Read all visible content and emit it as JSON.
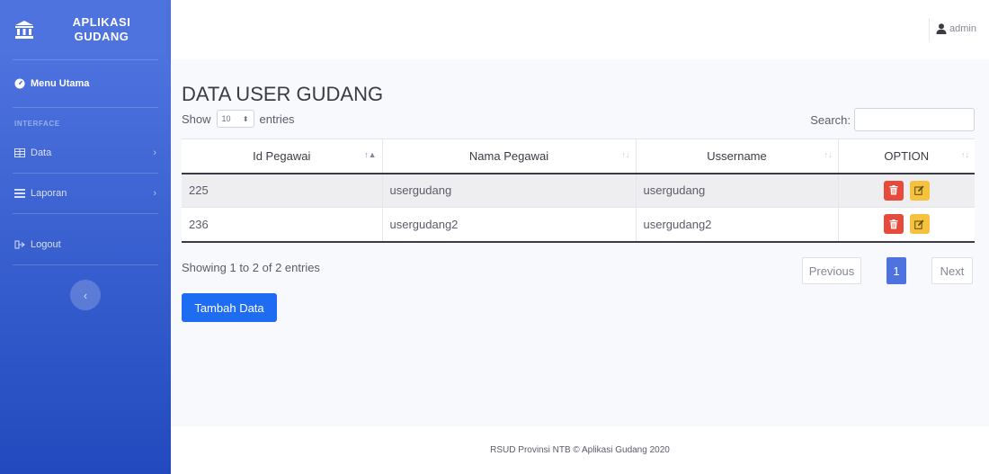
{
  "sidebar": {
    "brand_line1": "APLIKASI",
    "brand_line2": "GUDANG",
    "menu_utama": "Menu Utama",
    "heading": "INTERFACE",
    "items": [
      {
        "label": "Data",
        "icon": "table-icon"
      },
      {
        "label": "Laporan",
        "icon": "list-icon"
      }
    ],
    "logout": "Logout"
  },
  "topbar": {
    "user": "admin"
  },
  "main": {
    "title": "DATA USER GUDANG",
    "show_label": "Show",
    "entries_value": "10",
    "entries_label": "entries",
    "search_label": "Search:",
    "search_value": ""
  },
  "table": {
    "columns": [
      "Id Pegawai",
      "Nama Pegawai",
      "Ussername",
      "OPTION"
    ],
    "rows": [
      {
        "id": "225",
        "nama": "usergudang",
        "username": "usergudang"
      },
      {
        "id": "236",
        "nama": "usergudang2",
        "username": "usergudang2"
      }
    ]
  },
  "pagination": {
    "info": "Showing 1 to 2 of 2 entries",
    "previous": "Previous",
    "current_page": "1",
    "next": "Next"
  },
  "add_button": "Tambah Data",
  "footer": "RSUD Provinsi NTB © Aplikasi Gudang 2020",
  "colors": {
    "sidebar_top": "#4e73df",
    "sidebar_bottom": "#224abe",
    "danger": "#e74a3b",
    "warning": "#f6c23e",
    "primary": "#1d6cf2"
  }
}
